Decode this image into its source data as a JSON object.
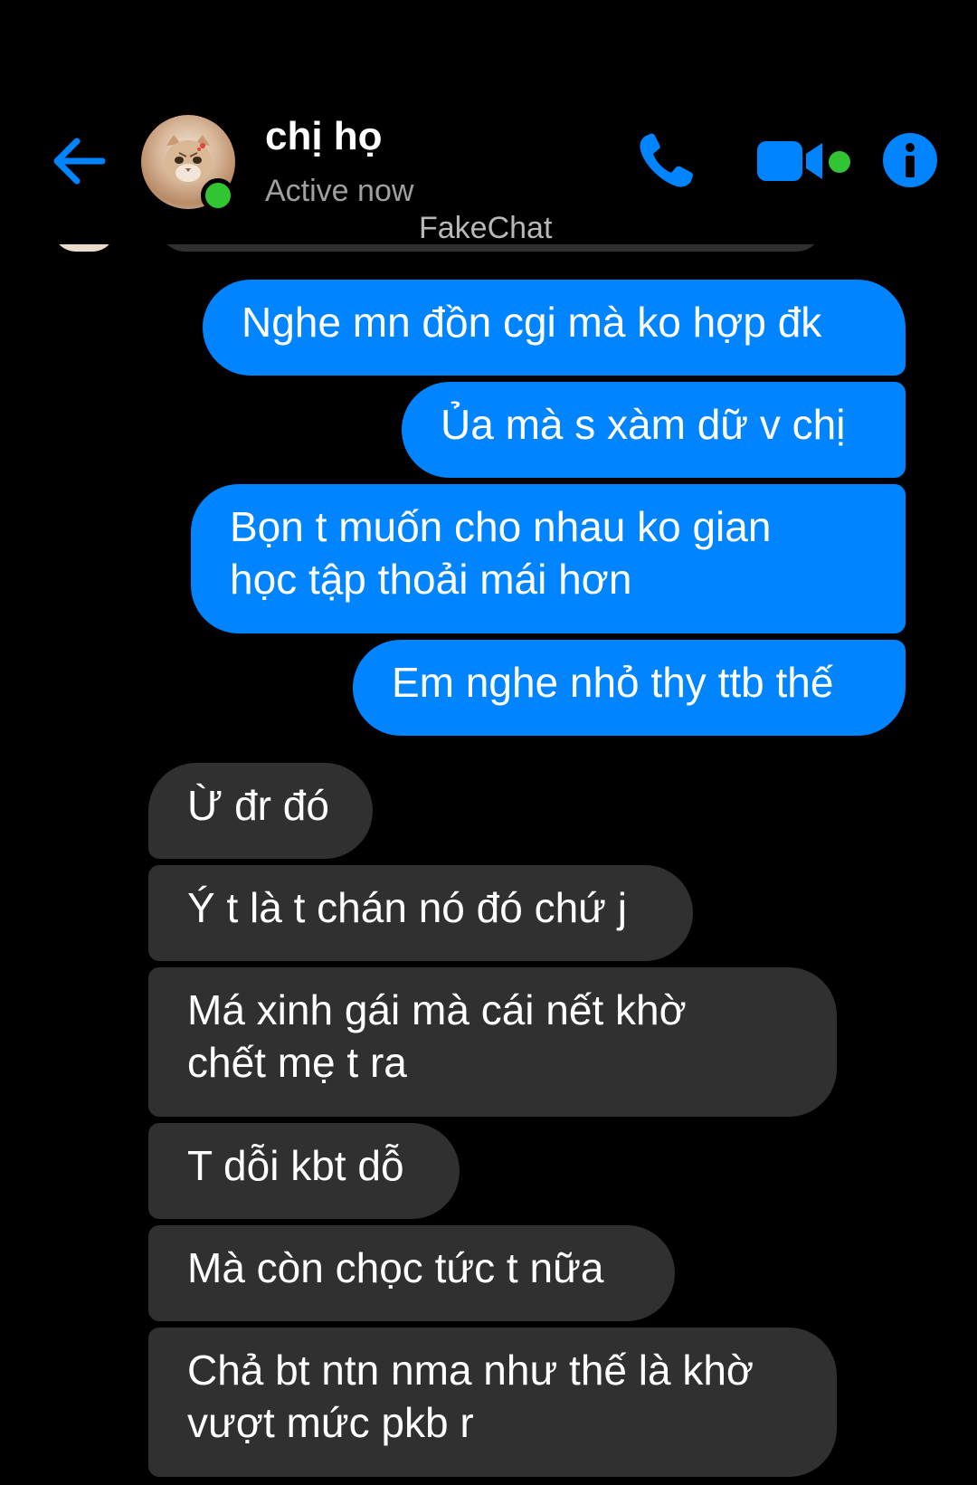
{
  "header": {
    "contact_name": "chị họ",
    "status": "Active now",
    "watermark": "FakeChat",
    "icons": {
      "back": "back-arrow-icon",
      "call": "phone-icon",
      "video": "video-camera-icon",
      "info": "info-icon"
    }
  },
  "colors": {
    "accent": "#0084ff",
    "online": "#31c534",
    "received_bubble": "#303030",
    "background": "#000000"
  },
  "messages": [
    {
      "direction": "sent",
      "text": "Nghe mn đồn cgi mà ko hợp đk"
    },
    {
      "direction": "sent",
      "text": "Ủa mà s xàm dữ v chị"
    },
    {
      "direction": "sent",
      "text": "Bọn t muốn cho nhau ko gian\nhọc tập thoải mái hơn"
    },
    {
      "direction": "sent",
      "text": "Em nghe nhỏ thy ttb thế"
    },
    {
      "direction": "received",
      "text": "Ừ đr đó"
    },
    {
      "direction": "received",
      "text": "Ý t là t chán nó đó chứ j"
    },
    {
      "direction": "received",
      "text": "Má xinh gái mà cái nết khờ\nchết mẹ t ra"
    },
    {
      "direction": "received",
      "text": "T dỗi kbt dỗ"
    },
    {
      "direction": "received",
      "text": "Mà còn chọc tức t nữa"
    },
    {
      "direction": "received",
      "text": "Chả bt ntn nma như thế là khờ\nvượt mức pkb r"
    }
  ]
}
